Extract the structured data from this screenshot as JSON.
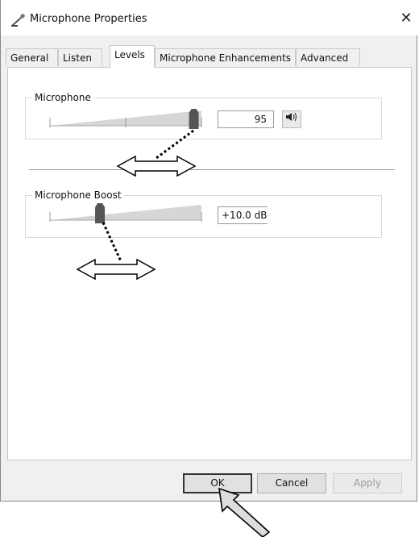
{
  "window": {
    "title": "Microphone Properties",
    "close_glyph": "✕"
  },
  "tabs": [
    {
      "label": "General"
    },
    {
      "label": "Listen"
    },
    {
      "label": "Levels"
    },
    {
      "label": "Microphone Enhancements"
    },
    {
      "label": "Advanced"
    }
  ],
  "active_tab": "Levels",
  "microphone": {
    "group_label": "Microphone",
    "value": "95",
    "level_fraction": 0.95,
    "mute_icon": "speaker-icon"
  },
  "boost": {
    "group_label": "Microphone Boost",
    "value": "+10.0 dB",
    "level_fraction": 0.33
  },
  "buttons": {
    "ok": "OK",
    "cancel": "Cancel",
    "apply": "Apply"
  },
  "annotations": {
    "arrow_color": "#000000",
    "arrow_fill": "#ffffff"
  }
}
